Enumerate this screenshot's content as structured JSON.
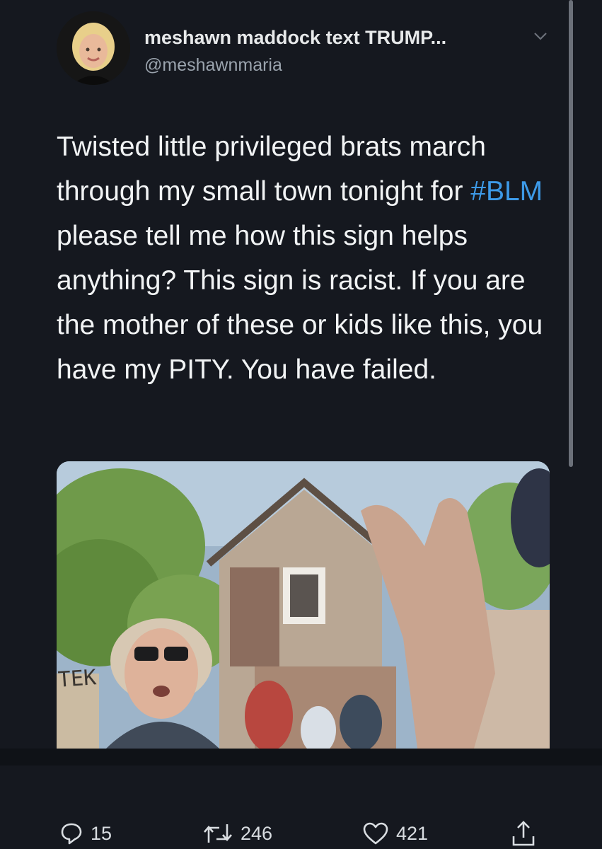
{
  "tweet": {
    "display_name": "meshawn maddock text TRUMP...",
    "handle": "@meshawnmaria",
    "text_part1": "Twisted little privileged brats march through my small town tonight for ",
    "hashtag": "#BLM",
    "text_part2": " please tell me how this sign helps anything? This sign is racist. If you are the mother of these or kids like this, you have my PITY. You have failed.",
    "media_sign_text": "TEK"
  },
  "actions": {
    "replies": "15",
    "retweets": "246",
    "likes": "421"
  },
  "colors": {
    "background": "#15181f",
    "hashtag": "#3d9ae8",
    "text": "#f1f3f4",
    "secondary": "#9aa3ad"
  },
  "icons": [
    "chevron-down-icon",
    "reply-icon",
    "retweet-icon",
    "like-icon",
    "share-icon"
  ]
}
